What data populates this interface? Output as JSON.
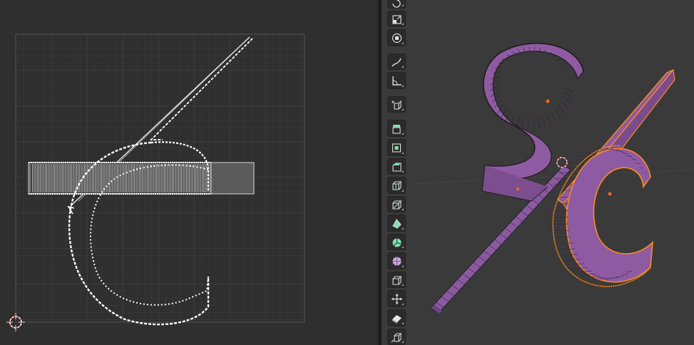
{
  "uv_editor": {
    "grid": "on",
    "background_color": "#2f2f2f",
    "selected_vertex_color": "#ffffff",
    "cursor_icon": "2d-cursor-icon"
  },
  "viewport_3d": {
    "background_color": "#3a3a3a",
    "mesh_color": "#8e5ba3",
    "selection_color": "#ff8a1c",
    "objects": [
      "s-letter-mesh",
      "c-letter-mesh",
      "slash-bar-mesh"
    ]
  },
  "toolbar": {
    "tools": [
      {
        "icon": "rotate-icon"
      },
      {
        "icon": "scale-icon"
      },
      {
        "icon": "transform-icon"
      },
      {
        "icon": "annotate-icon"
      },
      {
        "icon": "measure-icon"
      },
      {
        "icon": "add-cube-icon"
      },
      {
        "icon": "extrude-region-icon"
      },
      {
        "icon": "inset-faces-icon"
      },
      {
        "icon": "bevel-icon"
      },
      {
        "icon": "loop-cut-icon"
      },
      {
        "icon": "knife-icon"
      },
      {
        "icon": "poly-build-icon"
      },
      {
        "icon": "spin-icon"
      },
      {
        "icon": "smooth-icon"
      },
      {
        "icon": "edge-slide-icon"
      },
      {
        "icon": "shrink-fatten-icon"
      },
      {
        "icon": "shear-icon"
      },
      {
        "icon": "rip-region-icon"
      }
    ]
  }
}
